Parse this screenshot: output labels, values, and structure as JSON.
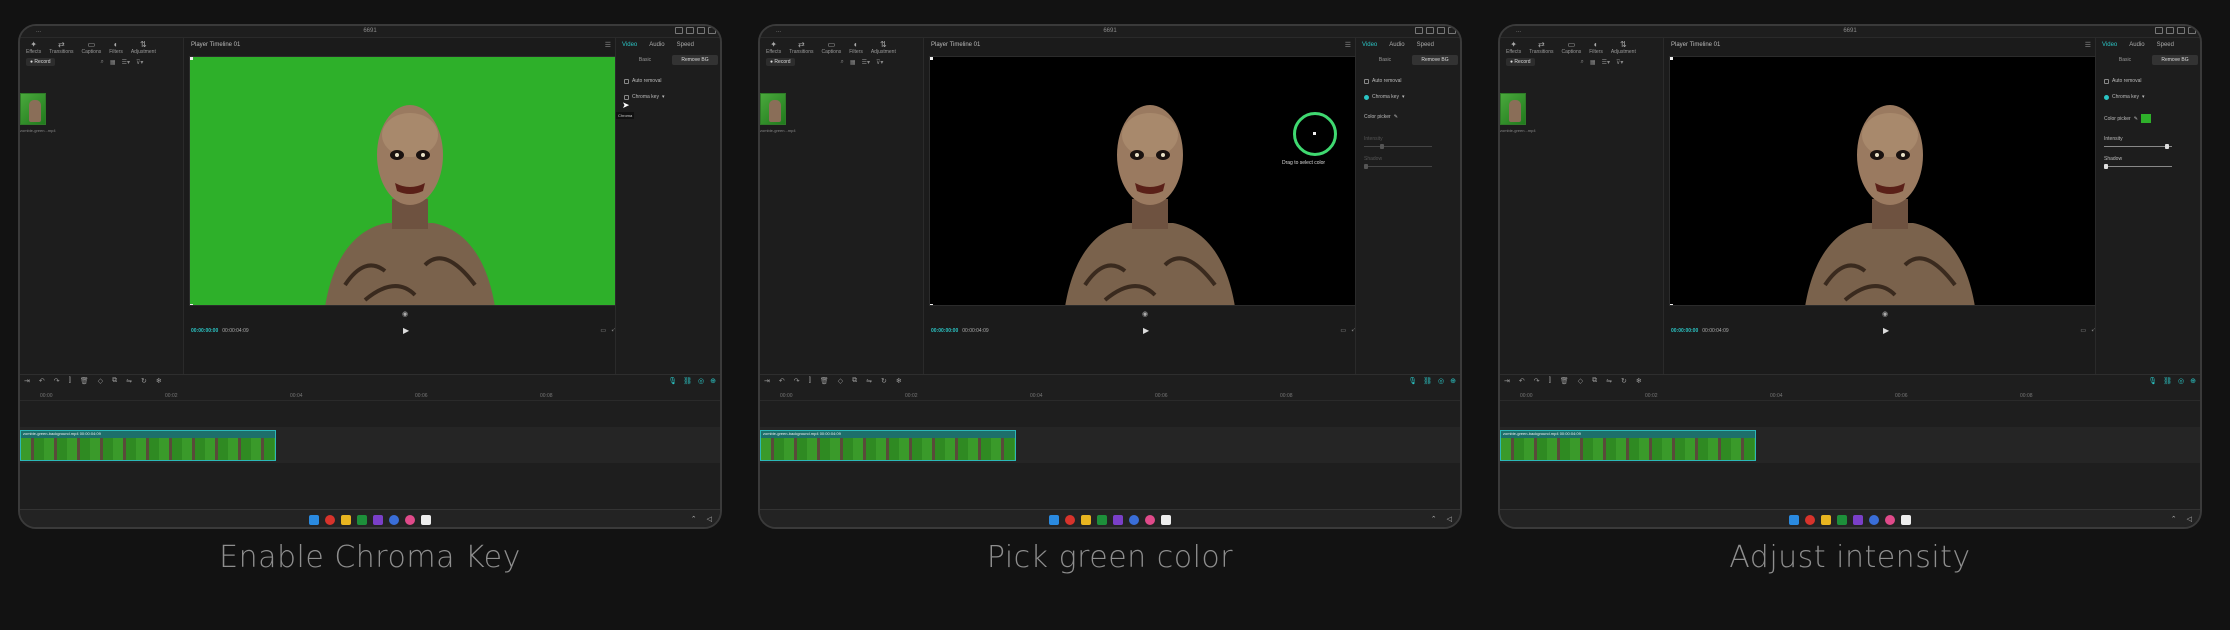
{
  "panels": [
    {
      "caption": "Enable Chroma Key",
      "title_left": "...",
      "title_center": "6691",
      "state": "enable",
      "player_title": "Player Timeline 01",
      "timecode_current": "00:00:00:00",
      "timecode_total": "00:00:04:09",
      "inspector": {
        "tabs": [
          "Video",
          "Audio",
          "Speed"
        ],
        "subtabs": [
          "Basic",
          "Remove BG"
        ],
        "auto_removal": "Auto removal",
        "chroma_key": "Chroma key",
        "chroma_checked": false,
        "tooltip": "Chroma"
      }
    },
    {
      "caption": "Pick green color",
      "title_left": "...",
      "title_center": "6691",
      "state": "pick",
      "player_title": "Player Timeline 01",
      "timecode_current": "00:00:00:00",
      "timecode_total": "00:00:04:09",
      "picker_text": "Drag to select color",
      "inspector": {
        "tabs": [
          "Video",
          "Audio",
          "Speed"
        ],
        "subtabs": [
          "Basic",
          "Remove BG"
        ],
        "auto_removal": "Auto removal",
        "chroma_key": "Chroma key",
        "chroma_checked": true,
        "color_picker": "Color picker",
        "intensity": "Intensity",
        "shadow": "Shadow"
      }
    },
    {
      "caption": "Adjust intensity",
      "title_left": "...",
      "title_center": "6691",
      "state": "adjust",
      "player_title": "Player Timeline 01",
      "timecode_current": "00:00:00:00",
      "timecode_total": "00:00:04:09",
      "inspector": {
        "tabs": [
          "Video",
          "Audio",
          "Speed"
        ],
        "subtabs": [
          "Basic",
          "Remove BG"
        ],
        "auto_removal": "Auto removal",
        "chroma_key": "Chroma key",
        "chroma_checked": true,
        "color_picker": "Color picker",
        "intensity": "Intensity",
        "intensity_value": 0.95,
        "shadow": "Shadow"
      }
    }
  ],
  "shared": {
    "tools": [
      "Effects",
      "Transitions",
      "Captions",
      "Filters",
      "Adjustment"
    ],
    "record_label": "Record",
    "media_label": "zombie-green...mp4",
    "clip_label": "zombie-green-background.mp4  00:00:04:09",
    "ruler": [
      "00:00",
      "00:02",
      "00:04",
      "00:06",
      "00:08"
    ],
    "colors": {
      "accent": "#2bc4c4",
      "green_screen": "#2eb02a",
      "clip": "#1d6f6b"
    }
  }
}
